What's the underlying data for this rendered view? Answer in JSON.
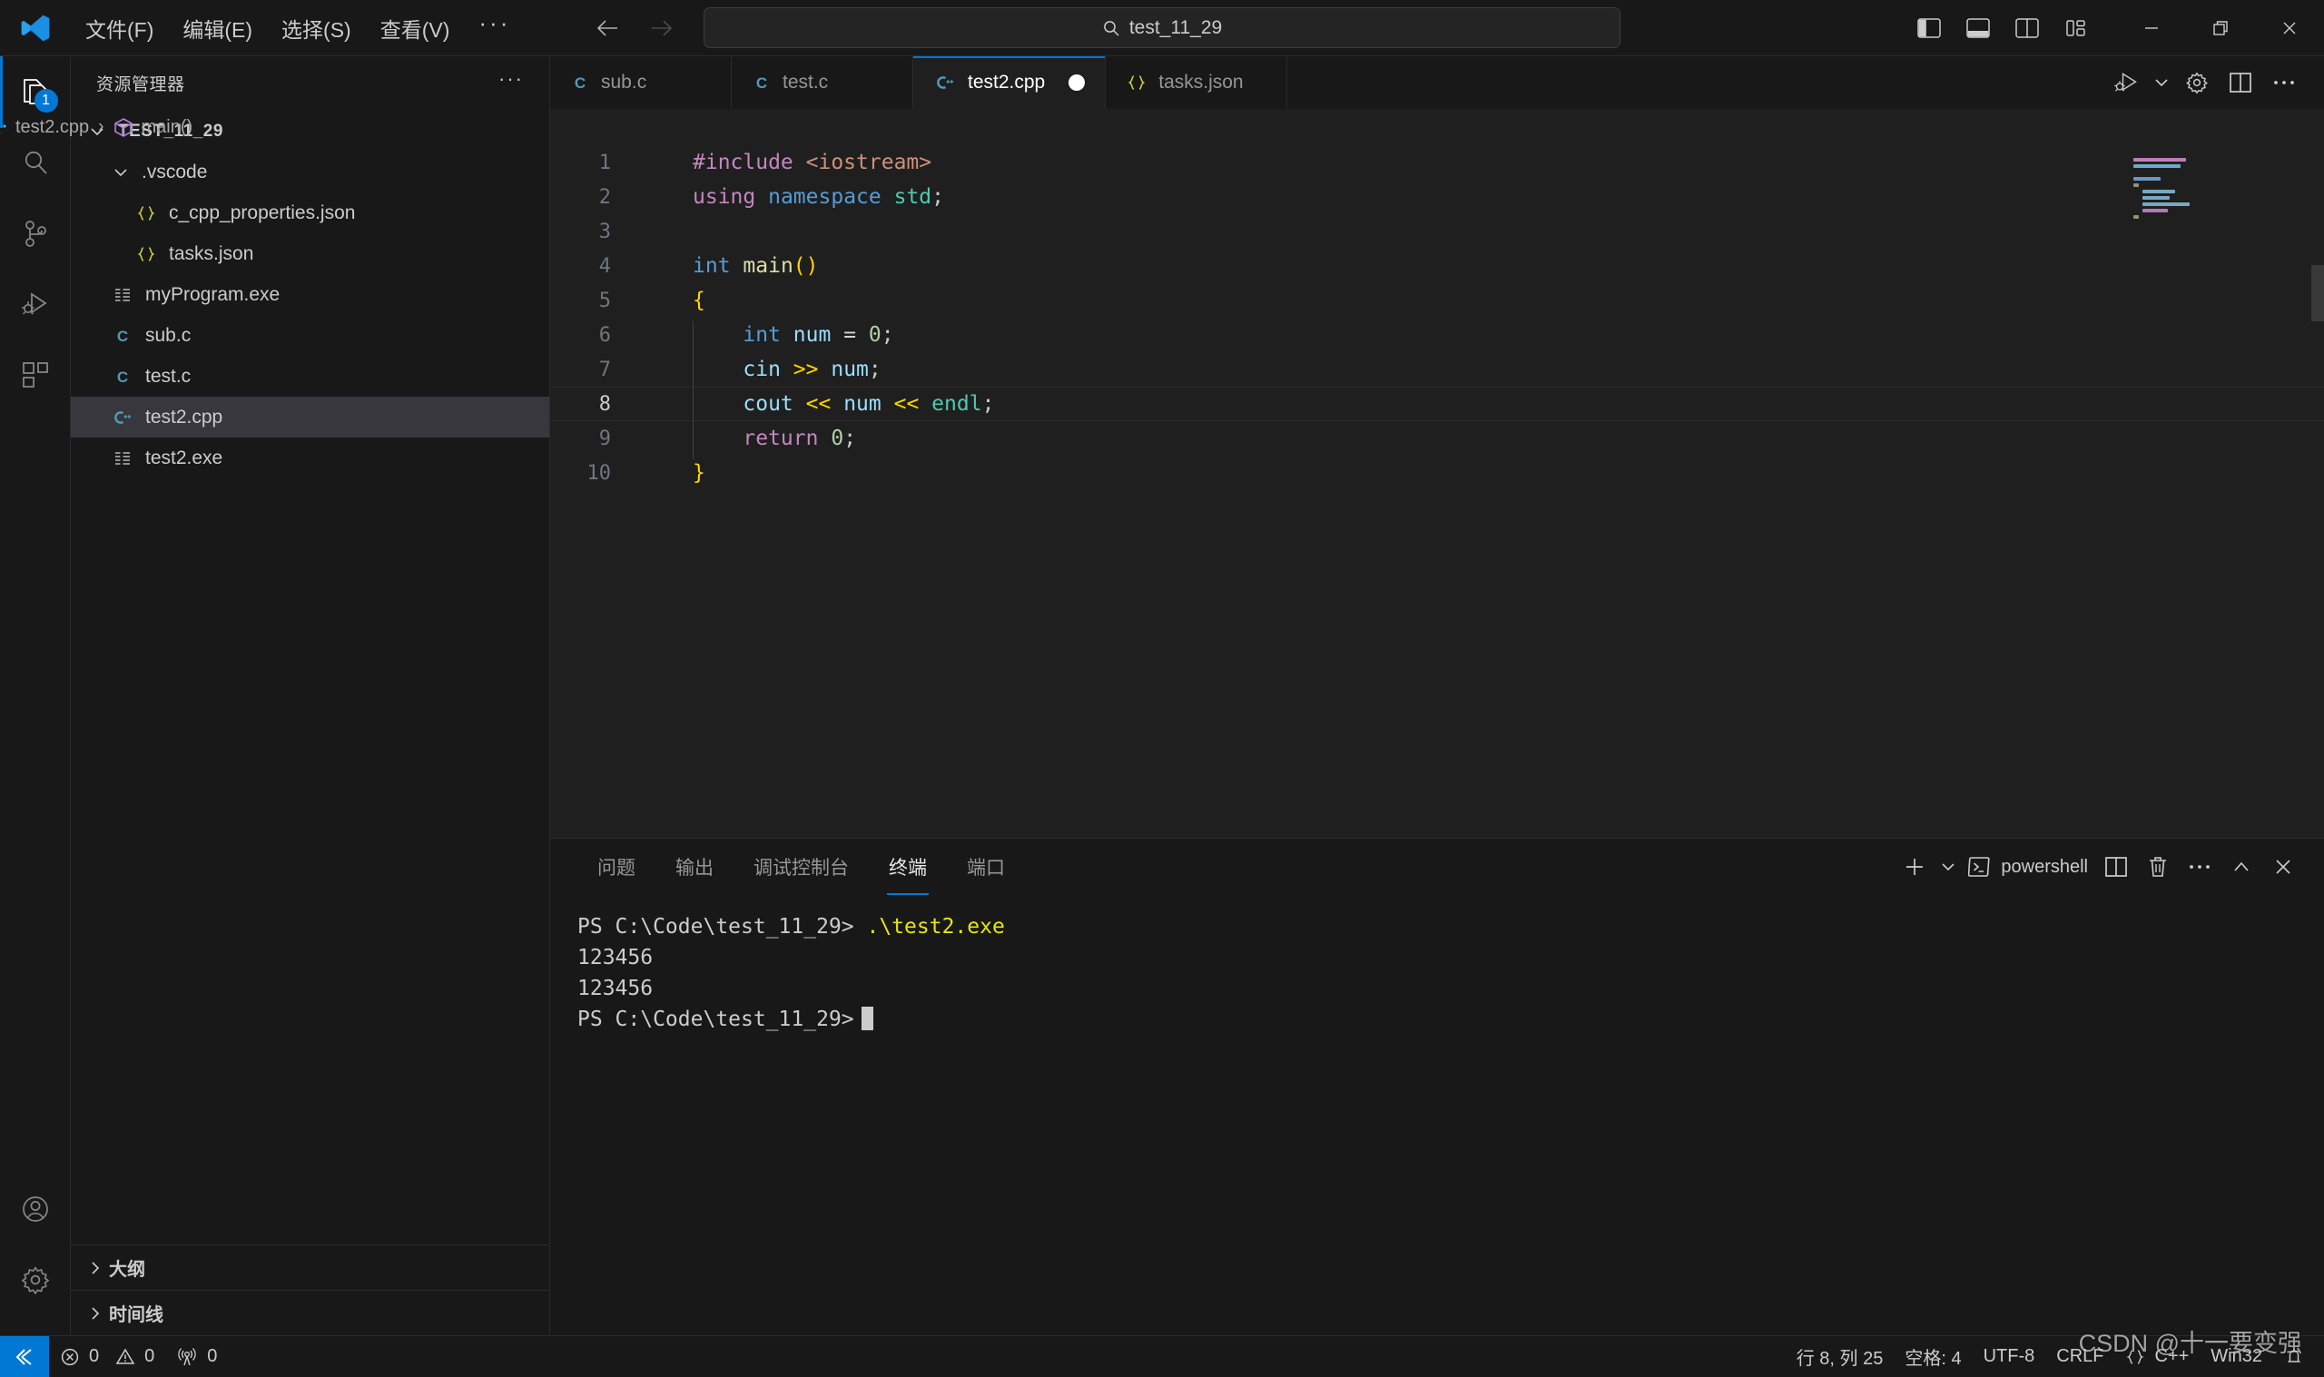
{
  "titlebar": {
    "menus": [
      "文件(F)",
      "编辑(E)",
      "选择(S)",
      "查看(V)"
    ],
    "more": "···",
    "back_icon": "arrow-left-icon",
    "forward_icon": "arrow-right-icon",
    "search_text": "test_11_29",
    "layout_toggles": [
      "toggle-primary-sidebar",
      "toggle-panel",
      "toggle-secondary-sidebar",
      "customize-layout"
    ],
    "window_minimize": "—",
    "window_restore": "❐",
    "window_close": "✕"
  },
  "activitybar": {
    "items": [
      {
        "name": "explorer",
        "icon": "files-icon",
        "badge": "1",
        "active": true
      },
      {
        "name": "search",
        "icon": "search-icon",
        "badge": "",
        "active": false
      },
      {
        "name": "source-control",
        "icon": "source-control-icon",
        "badge": "",
        "active": false
      },
      {
        "name": "run-and-debug",
        "icon": "run-debug-icon",
        "badge": "",
        "active": false
      },
      {
        "name": "extensions",
        "icon": "extensions-icon",
        "badge": "",
        "active": false
      }
    ],
    "bottom": [
      {
        "name": "accounts",
        "icon": "account-icon"
      },
      {
        "name": "manage",
        "icon": "gear-icon"
      }
    ]
  },
  "sidebar": {
    "title": "资源管理器",
    "more": "···",
    "tree": [
      {
        "label": "TEST_11_29",
        "icon": "chevron-down-icon",
        "kind": "root",
        "indent": 0,
        "selected": false
      },
      {
        "label": ".vscode",
        "icon": "chevron-down-icon",
        "kind": "folder",
        "indent": 1,
        "selected": false
      },
      {
        "label": "c_cpp_properties.json",
        "icon": "json-icon",
        "kind": "file",
        "indent": 2,
        "selected": false
      },
      {
        "label": "tasks.json",
        "icon": "json-icon",
        "kind": "file",
        "indent": 2,
        "selected": false
      },
      {
        "label": "myProgram.exe",
        "icon": "binary-icon",
        "kind": "file",
        "indent": 1,
        "selected": false
      },
      {
        "label": "sub.c",
        "icon": "c-icon",
        "kind": "file",
        "indent": 1,
        "selected": false
      },
      {
        "label": "test.c",
        "icon": "c-icon",
        "kind": "file",
        "indent": 1,
        "selected": false
      },
      {
        "label": "test2.cpp",
        "icon": "cpp-icon",
        "kind": "file",
        "indent": 1,
        "selected": true
      },
      {
        "label": "test2.exe",
        "icon": "binary-icon",
        "kind": "file",
        "indent": 1,
        "selected": false
      }
    ],
    "sections": [
      {
        "label": "大纲",
        "icon": "chevron-right-icon"
      },
      {
        "label": "时间线",
        "icon": "chevron-right-icon"
      }
    ]
  },
  "editor": {
    "tabs": [
      {
        "label": "sub.c",
        "icon": "c-icon",
        "active": false,
        "dirty": false
      },
      {
        "label": "test.c",
        "icon": "c-icon",
        "active": false,
        "dirty": false
      },
      {
        "label": "test2.cpp",
        "icon": "cpp-icon",
        "active": true,
        "dirty": true
      },
      {
        "label": "tasks.json",
        "icon": "json-icon",
        "active": false,
        "dirty": false
      }
    ],
    "actions": [
      {
        "name": "run-or-debug",
        "icon": "run-debug-icon"
      },
      {
        "name": "run-dropdown",
        "icon": "chevron-down-icon"
      },
      {
        "name": "editor-settings",
        "icon": "gear-icon"
      },
      {
        "name": "split-editor",
        "icon": "split-editor-icon"
      },
      {
        "name": "more-actions",
        "icon": "ellipsis-icon"
      }
    ],
    "breadcrumb": {
      "file": "test2.cpp",
      "file_icon": "cpp-icon",
      "separator": "›",
      "symbol": "main()",
      "symbol_icon": "cube-icon"
    },
    "current_line": 8,
    "lines": [
      {
        "n": 1,
        "tokens": [
          {
            "t": "#include",
            "c": "t-pre"
          },
          {
            "t": " ",
            "c": "t-punc"
          },
          {
            "t": "<iostream>",
            "c": "t-str"
          }
        ]
      },
      {
        "n": 2,
        "tokens": [
          {
            "t": "using",
            "c": "t-key"
          },
          {
            "t": " ",
            "c": "t-punc"
          },
          {
            "t": "namespace",
            "c": "t-type"
          },
          {
            "t": " ",
            "c": "t-punc"
          },
          {
            "t": "std",
            "c": "t-ns"
          },
          {
            "t": ";",
            "c": "t-punc"
          }
        ]
      },
      {
        "n": 3,
        "tokens": []
      },
      {
        "n": 4,
        "tokens": [
          {
            "t": "int",
            "c": "t-type"
          },
          {
            "t": " ",
            "c": "t-punc"
          },
          {
            "t": "main",
            "c": "t-fn"
          },
          {
            "t": "()",
            "c": "t-paren-y"
          }
        ]
      },
      {
        "n": 5,
        "tokens": [
          {
            "t": "{",
            "c": "t-brace-y"
          }
        ]
      },
      {
        "n": 6,
        "tokens": [
          {
            "t": "    ",
            "c": "t-punc"
          },
          {
            "t": "int",
            "c": "t-type"
          },
          {
            "t": " ",
            "c": "t-punc"
          },
          {
            "t": "num",
            "c": "t-var"
          },
          {
            "t": " = ",
            "c": "t-op"
          },
          {
            "t": "0",
            "c": "t-num"
          },
          {
            "t": ";",
            "c": "t-punc"
          }
        ]
      },
      {
        "n": 7,
        "tokens": [
          {
            "t": "    ",
            "c": "t-punc"
          },
          {
            "t": "cin",
            "c": "t-var"
          },
          {
            "t": " ",
            "c": "t-punc"
          },
          {
            "t": ">>",
            "c": "t-brace-y"
          },
          {
            "t": " ",
            "c": "t-punc"
          },
          {
            "t": "num",
            "c": "t-var"
          },
          {
            "t": ";",
            "c": "t-punc"
          }
        ]
      },
      {
        "n": 8,
        "tokens": [
          {
            "t": "    ",
            "c": "t-punc"
          },
          {
            "t": "cout",
            "c": "t-var"
          },
          {
            "t": " ",
            "c": "t-punc"
          },
          {
            "t": "<<",
            "c": "t-brace-y"
          },
          {
            "t": " ",
            "c": "t-punc"
          },
          {
            "t": "num",
            "c": "t-var"
          },
          {
            "t": " ",
            "c": "t-punc"
          },
          {
            "t": "<<",
            "c": "t-brace-y"
          },
          {
            "t": " ",
            "c": "t-punc"
          },
          {
            "t": "endl",
            "c": "t-ns"
          },
          {
            "t": ";",
            "c": "t-punc"
          }
        ]
      },
      {
        "n": 9,
        "tokens": [
          {
            "t": "    ",
            "c": "t-punc"
          },
          {
            "t": "return",
            "c": "t-key"
          },
          {
            "t": " ",
            "c": "t-punc"
          },
          {
            "t": "0",
            "c": "t-num"
          },
          {
            "t": ";",
            "c": "t-punc"
          }
        ]
      },
      {
        "n": 10,
        "tokens": [
          {
            "t": "}",
            "c": "t-brace-y"
          }
        ]
      }
    ]
  },
  "panel": {
    "tabs": [
      {
        "label": "问题",
        "active": false
      },
      {
        "label": "输出",
        "active": false
      },
      {
        "label": "调试控制台",
        "active": false
      },
      {
        "label": "终端",
        "active": true
      },
      {
        "label": "端口",
        "active": false
      }
    ],
    "actions": {
      "new_terminal": "+",
      "new_terminal_dropdown": "chevron-down-icon",
      "shell_icon": "terminal-icon",
      "shell_label": "powershell",
      "split": "split-terminal-icon",
      "kill": "trash-icon",
      "more": "ellipsis-icon",
      "maximize": "chevron-up-icon",
      "close": "close-icon"
    },
    "terminal_lines": [
      {
        "prompt": "PS C:\\Code\\test_11_29>",
        "cmd": ".\\test2.exe",
        "output": ""
      },
      {
        "prompt": "",
        "cmd": "",
        "output": "123456"
      },
      {
        "prompt": "",
        "cmd": "",
        "output": "123456"
      },
      {
        "prompt": "PS C:\\Code\\test_11_29>",
        "cmd": "",
        "output": "",
        "cursor": true
      }
    ]
  },
  "statusbar": {
    "remote_icon": "remote-window-icon",
    "errors_icon": "error-icon",
    "errors": "0",
    "warnings_icon": "warning-icon",
    "warnings": "0",
    "ports_icon": "radio-tower-icon",
    "ports": "0",
    "cursor_position": "行 8, 列 25",
    "indentation": "空格: 4",
    "encoding": "UTF-8",
    "eol": "CRLF",
    "language_icon": "braces-icon",
    "language": "C++",
    "platform": "Win32",
    "bell_icon": "bell-icon"
  },
  "watermark": "CSDN @十一要变强",
  "colors": {
    "accent": "#0078d4",
    "titlebar_bg": "#181818",
    "editor_bg": "#1f1f1f",
    "sidebar_bg": "#181818",
    "text": "#cccccc",
    "terminal_cmd": "#e5e510"
  }
}
